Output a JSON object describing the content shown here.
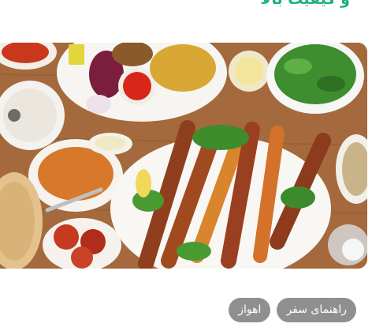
{
  "article": {
    "heading": "و کیفیت بالا",
    "image_description": "Platter of grilled kebabs, rice, herbs and Persian side dishes"
  },
  "tags": [
    {
      "label": "راهنمای سفر"
    },
    {
      "label": "اهواز"
    }
  ],
  "colors": {
    "heading": "#20b07a",
    "tag_bg": "#8f8f8f",
    "tag_text": "#ffffff"
  }
}
